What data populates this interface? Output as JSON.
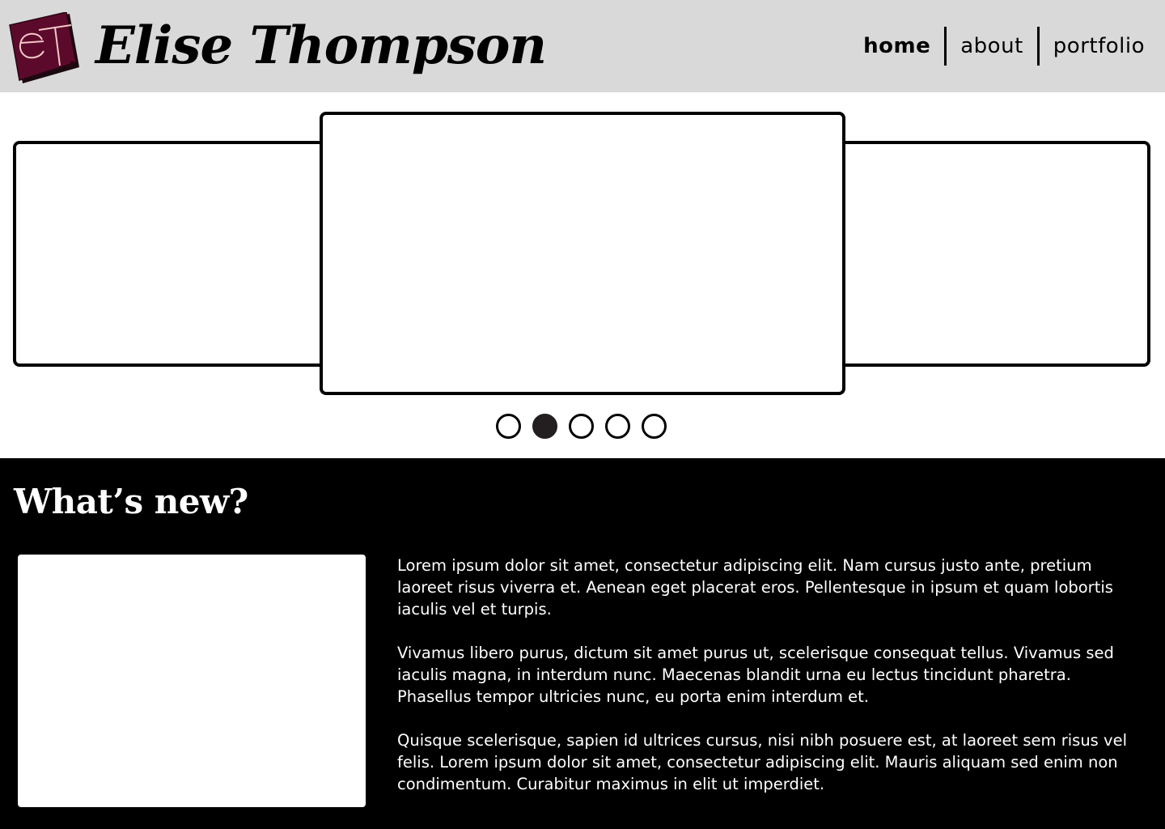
{
  "header": {
    "logo_icon": "et-monogram-logo",
    "logo_color": "#5c0a2c",
    "title": "Elise Thompson",
    "nav": [
      {
        "label": "home",
        "active": true
      },
      {
        "label": "about",
        "active": false
      },
      {
        "label": "portfolio",
        "active": false
      }
    ]
  },
  "carousel": {
    "slide_count": 5,
    "active_index": 1
  },
  "news": {
    "heading": "What’s new?",
    "paragraphs": [
      "Lorem ipsum dolor sit amet, consectetur adipiscing elit. Nam cursus justo ante, pretium laoreet risus viverra et. Aenean eget placerat eros. Pellentesque in ipsum et quam lobortis iaculis vel et turpis.",
      "Vivamus libero purus, dictum sit amet purus ut, scelerisque consequat tellus. Vivamus sed iaculis magna, in interdum nunc. Maecenas blandit urna eu lectus tincidunt pharetra. Phasellus tempor ultricies nunc, eu porta enim interdum et.",
      "Quisque scelerisque, sapien id ultrices cursus, nisi nibh posuere est, at laoreet sem risus vel felis. Lorem ipsum dolor sit amet, consectetur adipiscing elit. Mauris aliquam sed enim non condimentum. Curabitur maximus in elit ut imperdiet."
    ]
  }
}
